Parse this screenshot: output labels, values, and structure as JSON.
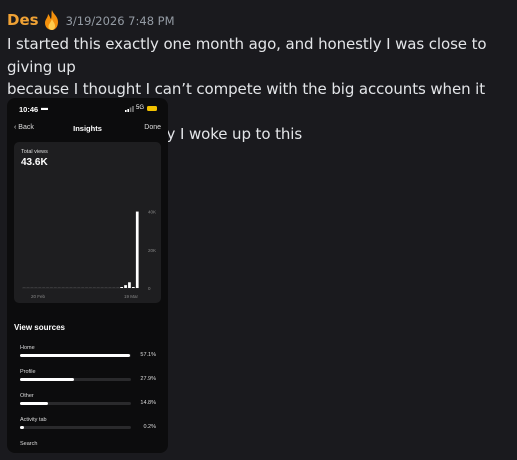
{
  "message": {
    "author": "Des",
    "author_color": "#f0a235",
    "emoji": "fire-emoji",
    "timestamp": "3/19/2026 7:48 PM",
    "lines": [
      "I started this exactly one month ago, and honestly I was close to giving up",
      "because I thought I can’t compete with the big accounts when it comes to",
      "ads or anything. Today I woke up to this"
    ]
  },
  "phone": {
    "status_time": "10:46",
    "network": "5G",
    "nav": {
      "back": "‹ Back",
      "title": "Insights",
      "done": "Done"
    },
    "total_views_label": "Total views",
    "total_views_value": "43.6K",
    "view_sources_title": "View sources",
    "sources": [
      {
        "label": "Home",
        "percent_text": "57.1%",
        "fraction": 0.571
      },
      {
        "label": "Profile",
        "percent_text": "27.9%",
        "fraction": 0.279
      },
      {
        "label": "Other",
        "percent_text": "14.8%",
        "fraction": 0.148
      },
      {
        "label": "Activity tab",
        "percent_text": "0.2%",
        "fraction": 0.002
      },
      {
        "label": "Search",
        "percent_text": "",
        "fraction": 0
      }
    ]
  },
  "chart_data": {
    "type": "bar",
    "title": "Total views",
    "ylim": [
      0,
      45000
    ],
    "y_ticks": [
      "40K",
      "20K",
      "0"
    ],
    "y_tick_values": [
      40000,
      20000,
      0
    ],
    "x_tick_labels": [
      "20 Feb",
      "19 Mar"
    ],
    "values": [
      0,
      0,
      0,
      0,
      0,
      0,
      0,
      0,
      0,
      0,
      0,
      0,
      0,
      0,
      0,
      0,
      0,
      0,
      0,
      0,
      0,
      0,
      0,
      0,
      0,
      200,
      1500,
      3000,
      500,
      40000
    ],
    "grid": false,
    "bar_color": "#ffffff"
  }
}
